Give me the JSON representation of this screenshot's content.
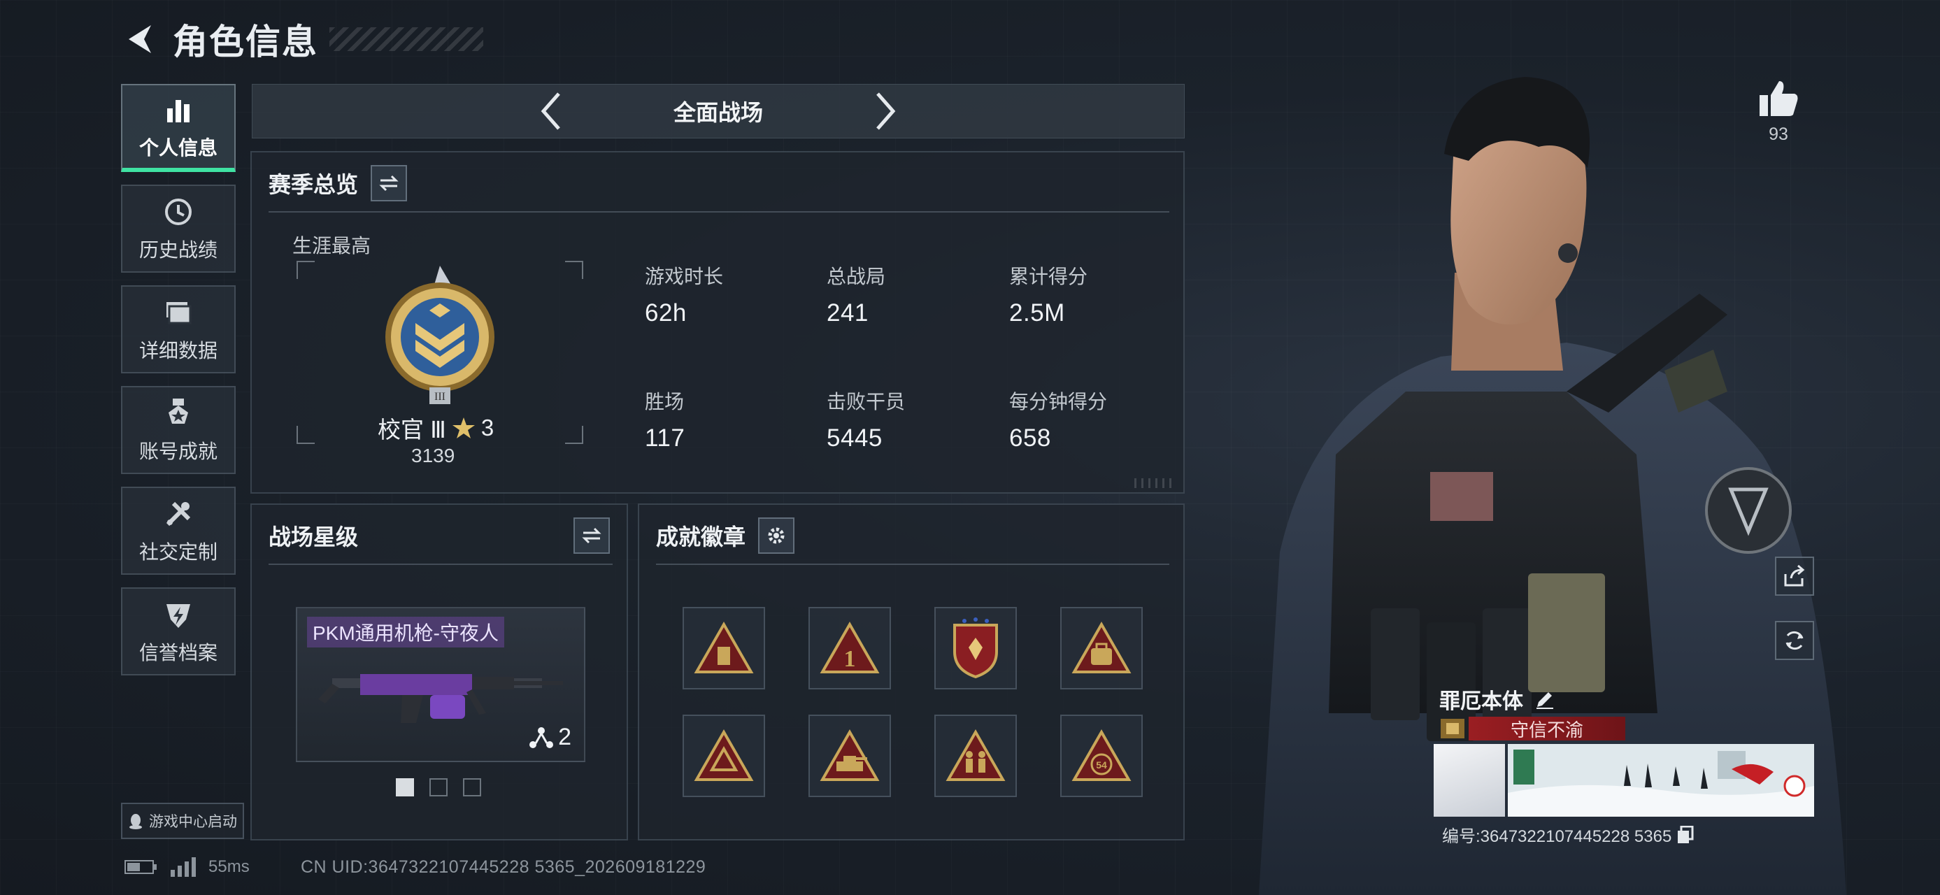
{
  "header": {
    "title": "角色信息"
  },
  "nav": {
    "items": [
      {
        "label": "个人信息",
        "icon": "bar-chart-icon",
        "active": true
      },
      {
        "label": "历史战绩",
        "icon": "history-clock-icon",
        "active": false
      },
      {
        "label": "详细数据",
        "icon": "folder-icon",
        "active": false
      },
      {
        "label": "账号成就",
        "icon": "achievement-medal-icon",
        "active": false
      },
      {
        "label": "社交定制",
        "icon": "tools-icon",
        "active": false
      },
      {
        "label": "信誉档案",
        "icon": "shield-lightning-icon",
        "active": false
      }
    ],
    "game_center_label": "游戏中心启动"
  },
  "status": {
    "ping": "55ms",
    "uid": "CN UID:3647322107445228 5365_202609181229"
  },
  "mode": {
    "label": "全面战场"
  },
  "season": {
    "title": "赛季总览",
    "career_label": "生涯最高",
    "rank_name": "校官 Ⅲ",
    "rank_stars": "3",
    "rank_points": "3139",
    "stats": [
      {
        "label": "游戏时长",
        "value": "62h"
      },
      {
        "label": "总战局",
        "value": "241"
      },
      {
        "label": "累计得分",
        "value": "2.5M"
      },
      {
        "label": "胜场",
        "value": "117"
      },
      {
        "label": "击败干员",
        "value": "5445"
      },
      {
        "label": "每分钟得分",
        "value": "658"
      }
    ]
  },
  "star_level": {
    "title": "战场星级",
    "weapon_name": "PKM通用机枪-守夜人",
    "weapon_stars": "2",
    "page_current": 1,
    "page_total": 3
  },
  "badges": {
    "title": "成就徽章",
    "items": [
      "badge-usb-icon",
      "badge-rank1-icon",
      "badge-crest-icon",
      "badge-bag-icon",
      "badge-triangle-icon",
      "badge-tank-icon",
      "badge-soldiers-icon",
      "badge-54-icon"
    ]
  },
  "profile": {
    "likes": "93",
    "character_name": "罪厄本体",
    "title_text": "守信不渝",
    "character_id": "编号:3647322107445228 5365"
  },
  "colors": {
    "accent_green": "#3fe3a3",
    "title_red": "#9a1e22",
    "badge_gold": "#c9a75a"
  }
}
